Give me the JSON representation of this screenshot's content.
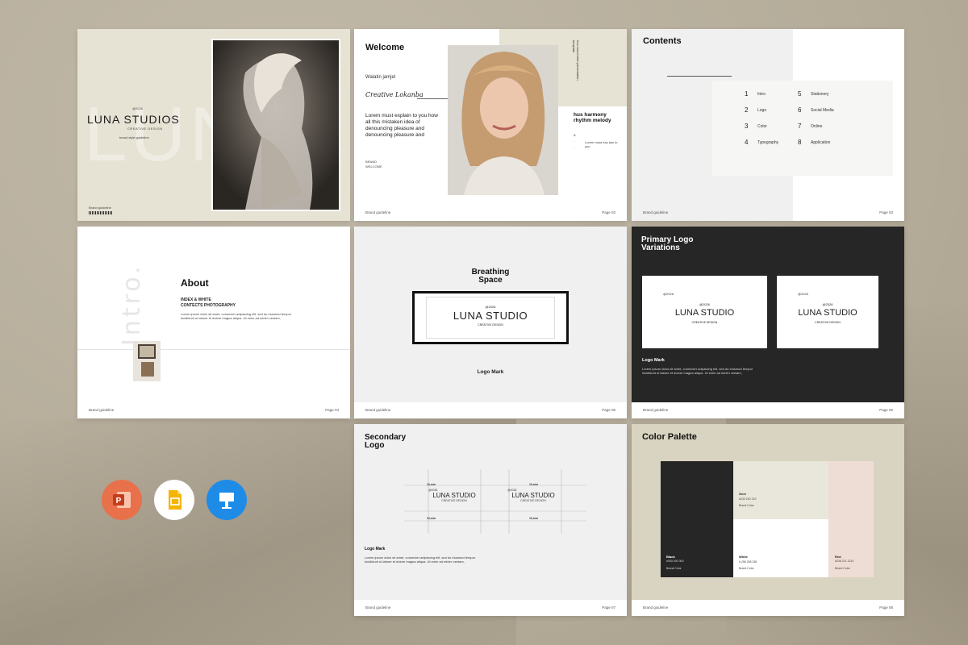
{
  "slides": {
    "s1": {
      "bg_text": "LUNA",
      "small_top": "@2026",
      "brand": "LUNA STUDIOS",
      "sub": "CREATIVE DESIGN",
      "tag": "brand style guideline",
      "footer": "Brand guideline"
    },
    "s2": {
      "title": "Welcome",
      "name": "Walatin jamjel",
      "signature": "Creative Lokanba",
      "body": "Lorem must explain to you how all this mistaken idea of denouncing pleasure and denouncing pleasure and",
      "label1": "BRAND",
      "label2": "WELCOME",
      "vert": "hus mood brief presentation template",
      "right_head": "hus harmony rhythm melody",
      "right_body": "Lorem must exp lain to you",
      "footer_l": "Brand guideline",
      "footer_r": "Page 02"
    },
    "s3": {
      "title": "Contents",
      "items": [
        {
          "n": "1",
          "label": "Intro"
        },
        {
          "n": "2",
          "label": "Logo"
        },
        {
          "n": "3",
          "label": "Color"
        },
        {
          "n": "4",
          "label": "Typography"
        },
        {
          "n": "5",
          "label": "Stationery"
        },
        {
          "n": "6",
          "label": "Social Media"
        },
        {
          "n": "7",
          "label": "Online"
        },
        {
          "n": "8",
          "label": "Application"
        }
      ],
      "footer_l": "Brand guideline",
      "footer_r": "Page 03"
    },
    "s4": {
      "vert": "Intro.",
      "title": "About",
      "sub1": "INDEX & WHITE",
      "sub2": "CONTECTS PHOTOGRAPHY",
      "body": "Lorem ipsum dolor sit amet, connecter adipiscing elit, sed do eiusmod tempor incididunt ut labore et dolore magna aliqua. Ut enim ad minim veniam,",
      "footer_l": "Brand guideline",
      "footer_r": "Page 04"
    },
    "s5": {
      "title1": "Breathing",
      "title2": "Space",
      "small": "@2026",
      "logo": "LUNA STUDIO",
      "logo_sub": "CREATIVE DESIGN",
      "caption": "Logo Mark",
      "footer_l": "Brand guideline",
      "footer_r": "Page 05"
    },
    "s6": {
      "title1": "Primary Logo",
      "title2": "Variations",
      "small": "@2026",
      "logo": "LUNA STUDIO",
      "logo_sub": "CREATIVE DESIGN",
      "caption": "Logo Mark",
      "body": "Lorem ipsum dolor sit amet, connecter adipiscing elit, sed do eiusmod tempor incididunt ut labore et dolore magna aliqua. Ut enim ad minim veniam,",
      "footer_l": "Brand guideline",
      "footer_r": "Page 06"
    },
    "s7": {
      "title1": "Secondary",
      "title2": "Logo",
      "dim": "10,mm",
      "small": "@2026",
      "logo": "LUNA STUDIO",
      "logo_sub": "CREATIVE DESIGN",
      "caption": "Logo Mark",
      "body": "Lorem ipsum dolor sit amet, connecter adipiscing elit, sed do eiusmod tempor incididunt ut labore et dolore magna aliqua. Ut enim ad minim veniam,",
      "footer_l": "Brand guideline",
      "footer_r": "Page 07"
    },
    "s8": {
      "title": "Color Palette",
      "swatches": [
        {
          "name": "Black",
          "code": "#000 000 000",
          "label": "Brand Color",
          "color": "#262626"
        },
        {
          "name": "Gere",
          "code": "#233 230 219",
          "label": "Brand Color",
          "color": "#e9e6db"
        },
        {
          "name": "White",
          "code": "# 255 255 255",
          "label": "Brand Color",
          "color": "#ffffff"
        },
        {
          "name": "Red",
          "code": "#238 221 2210",
          "label": "Brand Color",
          "color": "#eeddd5"
        }
      ],
      "footer_l": "Brand guideline",
      "footer_r": "Page 08"
    }
  },
  "apps": [
    {
      "name": "powerpoint-icon",
      "color": "#e8714b",
      "glyph": "P"
    },
    {
      "name": "google-slides-icon",
      "color": "#ffffff",
      "glyph": "▭"
    },
    {
      "name": "keynote-icon",
      "color": "#1e8ce6",
      "glyph": "⌂"
    }
  ]
}
